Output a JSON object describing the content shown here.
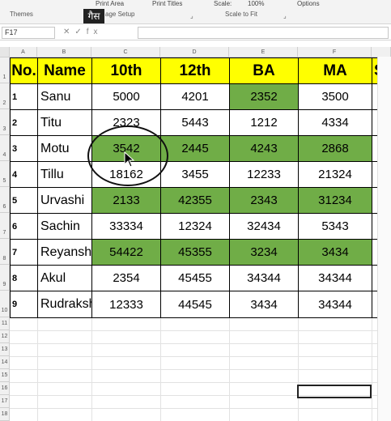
{
  "ribbon": {
    "print_area": "Print Area",
    "print_titles": "Print Titles",
    "scale": "Scale:",
    "scale_value": "100%",
    "options": "Options",
    "group_themes": "Themes",
    "group_page_setup": "age Setup",
    "group_scale": "Scale to Fit",
    "tooltip_overlay": "गैस"
  },
  "formula_bar": {
    "name_box": "F17",
    "fx": "fx"
  },
  "columns": [
    "A",
    "B",
    "C",
    "D",
    "E",
    "F"
  ],
  "rows": [
    "1",
    "2",
    "3",
    "4",
    "5",
    "6",
    "7",
    "8",
    "9",
    "10",
    "11",
    "12",
    "13",
    "14",
    "15",
    "16",
    "17",
    "18"
  ],
  "table": {
    "headers": [
      "No.",
      "Name",
      "10th",
      "12th",
      "BA",
      "MA",
      "S."
    ],
    "rows": [
      {
        "no": "1",
        "name": "Sanu",
        "v10": "5000",
        "v12": "4201",
        "ba": "2352",
        "ma": "3500"
      },
      {
        "no": "2",
        "name": "Titu",
        "v10": "2323",
        "v12": "5443",
        "ba": "1212",
        "ma": "4334"
      },
      {
        "no": "3",
        "name": "Motu",
        "v10": "3542",
        "v12": "2445",
        "ba": "4243",
        "ma": "2868"
      },
      {
        "no": "4",
        "name": "Tillu",
        "v10": "18162",
        "v12": "3455",
        "ba": "12233",
        "ma": "21324"
      },
      {
        "no": "5",
        "name": "Urvashi",
        "v10": "2133",
        "v12": "42355",
        "ba": "2343",
        "ma": "31234"
      },
      {
        "no": "6",
        "name": "Sachin",
        "v10": "33334",
        "v12": "12324",
        "ba": "32434",
        "ma": "5343"
      },
      {
        "no": "7",
        "name": "Reyansh",
        "v10": "54422",
        "v12": "45355",
        "ba": "3234",
        "ma": "3434"
      },
      {
        "no": "8",
        "name": "Akul",
        "v10": "2354",
        "v12": "45455",
        "ba": "34344",
        "ma": "34344"
      },
      {
        "no": "9",
        "name": "Rudraksh",
        "v10": "12333",
        "v12": "44545",
        "ba": "3434",
        "ma": "34344"
      }
    ]
  },
  "colors": {
    "header_fill": "#ffff00",
    "highlight_fill": "#70ad47"
  }
}
